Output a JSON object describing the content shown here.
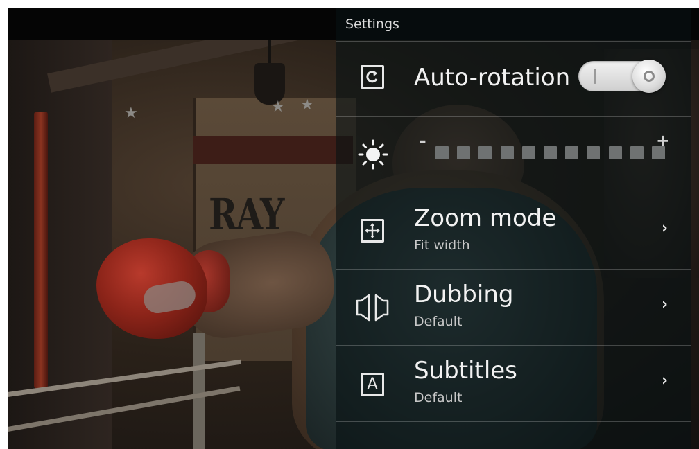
{
  "panel": {
    "title": "Settings"
  },
  "auto_rotation": {
    "label": "Auto-rotation",
    "enabled": true
  },
  "brightness": {
    "minus": "-",
    "plus": "+",
    "segments": 11,
    "level": 0
  },
  "zoom_mode": {
    "label": "Zoom mode",
    "value": "Fit width"
  },
  "dubbing": {
    "label": "Dubbing",
    "value": "Default"
  },
  "subtitles": {
    "label": "Subtitles",
    "value": "Default",
    "icon_letter": "A"
  },
  "chevron": "›",
  "video": {
    "sign_text": "RAY"
  }
}
